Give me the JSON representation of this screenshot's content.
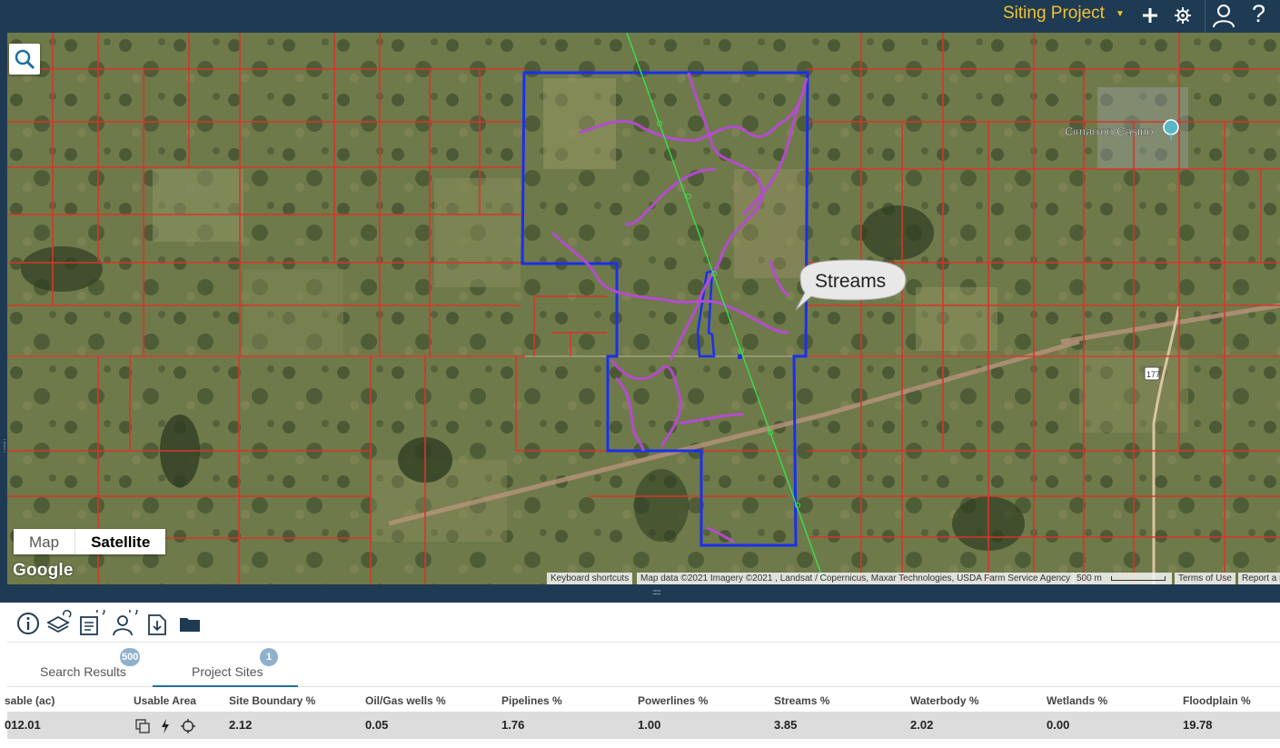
{
  "header": {
    "project_name": "Siting Project",
    "icons": [
      "dropdown-caret-icon",
      "add-icon",
      "settings-icon",
      "user-icon",
      "help-icon"
    ],
    "help_label": "?"
  },
  "map": {
    "map_type_options": [
      "Map",
      "Satellite"
    ],
    "active_map_type": "Satellite",
    "google_label": "Google",
    "place_label": "Cimarron Casino",
    "highway_label": "177",
    "callout_label": "Streams",
    "attribution": {
      "keyboard": "Keyboard shortcuts",
      "data": "Map data ©2021 Imagery ©2021 , Landsat / Copernicus, Maxar Technologies, USDA Farm Service Agency",
      "scale": "500 m",
      "terms": "Terms of Use",
      "report": "Report a m"
    },
    "colors": {
      "parcel": "#d8352a",
      "site_boundary": "#1b2ff0",
      "streams": "#b84ad6",
      "pipeline": "#39e04a"
    }
  },
  "toolbar": {
    "icons": [
      "info-icon",
      "layers-refresh-icon",
      "report-refresh-icon",
      "user-refresh-icon",
      "download-icon",
      "folder-icon"
    ]
  },
  "tabs": [
    {
      "label": "Search Results",
      "badge": "500",
      "active": false
    },
    {
      "label": "Project Sites",
      "badge": "1",
      "active": true
    }
  ],
  "table": {
    "columns": [
      "sable (ac)",
      "Usable Area",
      "Site Boundary %",
      "Oil/Gas wells %",
      "Pipelines %",
      "Powerlines %",
      "Streams %",
      "Waterbody %",
      "Wetlands %",
      "Floodplain %"
    ],
    "rows": [
      [
        "012.01",
        "",
        "2.12",
        "0.05",
        "1.76",
        "1.00",
        "3.85",
        "2.02",
        "0.00",
        "19.78"
      ]
    ]
  }
}
